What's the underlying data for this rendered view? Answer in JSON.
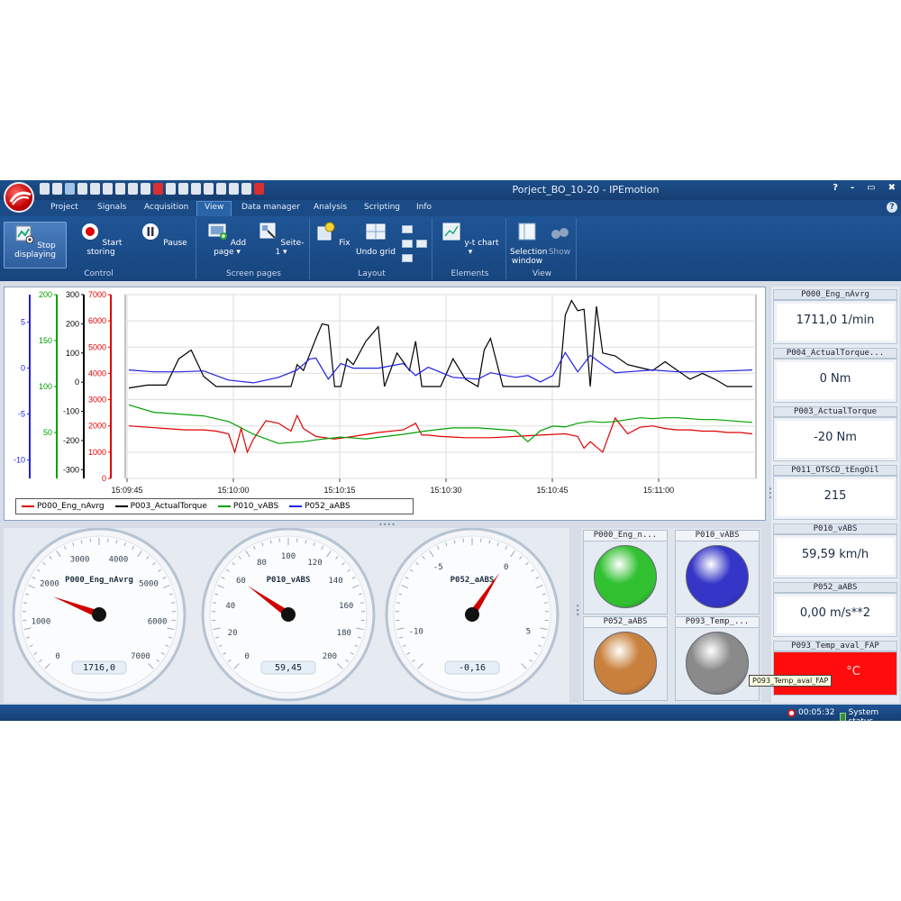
{
  "window": {
    "title": "Porject_BO_10-20 - IPEmotion"
  },
  "menu_tabs": [
    "Project",
    "Signals",
    "Acquisition",
    "View",
    "Data manager",
    "Analysis",
    "Scripting",
    "Info"
  ],
  "active_tab": "View",
  "window_buttons": {
    "help": "?",
    "minimize": "-",
    "restore": "▭",
    "close": "✖"
  },
  "ribbon": {
    "control": {
      "label": "Control",
      "stop_displaying": "Stop displaying",
      "start_storing": "Start storing",
      "pause": "Pause"
    },
    "screen_pages": {
      "label": "Screen pages",
      "add_page": "Add page ▾",
      "seite": "Seite-1 ▾"
    },
    "layout": {
      "label": "Layout",
      "fix": "Fix",
      "undo_grid": "Undo grid"
    },
    "elements": {
      "label": "Elements",
      "yt_chart": "y-t chart ▾"
    },
    "view": {
      "label": "View",
      "selection_window": "Selection window",
      "show": "Show"
    }
  },
  "chart_data": {
    "type": "line",
    "x_ticks": [
      "15:09:45",
      "15:10:00",
      "15:10:15",
      "15:10:30",
      "15:10:45",
      "15:11:00"
    ],
    "axes": [
      {
        "name": "P052_aABS",
        "color": "#2020e0",
        "ticks": [
          "5",
          "0",
          "-5",
          "-10"
        ],
        "range": [
          -12,
          8
        ]
      },
      {
        "name": "P010_vABS",
        "color": "#00a000",
        "ticks": [
          "200",
          "150",
          "100",
          "50"
        ],
        "range": [
          0,
          200
        ]
      },
      {
        "name": "P003_ActualTorque",
        "color": "#000000",
        "ticks": [
          "300",
          "200",
          "100",
          "0",
          "-100",
          "-200",
          "-300"
        ],
        "range": [
          -330,
          300
        ]
      },
      {
        "name": "P000_Eng_nAvrg",
        "color": "#e00000",
        "ticks": [
          "7000",
          "6000",
          "5000",
          "4000",
          "3000",
          "2000",
          "1000",
          "0"
        ],
        "range": [
          0,
          7000
        ]
      }
    ],
    "series": [
      {
        "name": "P000_Eng_nAvrg",
        "color": "#e00000",
        "x": [
          0,
          3,
          6,
          9,
          12,
          14,
          16,
          17,
          18,
          19,
          20,
          22,
          24,
          26,
          27,
          28,
          30,
          33,
          36,
          40,
          44,
          46,
          47,
          48,
          50,
          54,
          58,
          62,
          66,
          70,
          72,
          73,
          74,
          76,
          78,
          80,
          82,
          84,
          85,
          86,
          88,
          90,
          92,
          94,
          96,
          98,
          100
        ],
        "y": [
          2000,
          1950,
          1900,
          1850,
          1850,
          1800,
          1700,
          1000,
          1900,
          1000,
          1500,
          2200,
          2100,
          1800,
          2400,
          1900,
          1600,
          1500,
          1600,
          1750,
          1850,
          2100,
          1650,
          1650,
          1600,
          1550,
          1550,
          1600,
          1650,
          1700,
          1600,
          1150,
          1400,
          1000,
          2300,
          1700,
          1950,
          2000,
          1950,
          1900,
          1850,
          1850,
          1800,
          1800,
          1750,
          1750,
          1700
        ]
      },
      {
        "name": "P003_ActualTorque",
        "color": "#000000",
        "x": [
          0,
          3,
          6,
          8,
          10,
          12,
          14,
          16,
          20,
          22,
          24,
          26,
          27,
          28,
          30,
          31,
          32,
          33,
          34,
          35,
          36,
          38,
          40,
          41,
          43,
          45,
          46,
          47,
          48,
          50,
          52,
          54,
          56,
          57,
          58,
          60,
          62,
          64,
          66,
          68,
          69,
          70,
          71,
          72,
          73,
          74,
          75,
          76,
          78,
          80,
          82,
          84,
          86,
          88,
          90,
          92,
          94,
          96,
          98,
          100
        ],
        "y": [
          -20,
          -10,
          -10,
          80,
          110,
          20,
          -15,
          -15,
          -15,
          -15,
          -15,
          -15,
          60,
          40,
          150,
          200,
          195,
          -15,
          -15,
          80,
          60,
          140,
          190,
          -15,
          100,
          40,
          140,
          -15,
          -15,
          -15,
          80,
          10,
          -15,
          110,
          150,
          -15,
          -15,
          -15,
          -15,
          -15,
          -15,
          230,
          280,
          245,
          250,
          -15,
          260,
          100,
          90,
          60,
          50,
          40,
          70,
          40,
          10,
          30,
          10,
          -15,
          -15,
          -15
        ]
      },
      {
        "name": "P010_vABS",
        "color": "#00a000",
        "x": [
          0,
          4,
          8,
          12,
          16,
          20,
          24,
          28,
          30,
          34,
          38,
          44,
          48,
          52,
          56,
          58,
          60,
          62,
          64,
          66,
          68,
          70,
          72,
          74,
          76,
          78,
          80,
          82,
          84,
          86,
          88,
          90,
          92,
          94,
          96,
          98,
          100
        ],
        "y": [
          80,
          72,
          70,
          68,
          62,
          48,
          38,
          40,
          42,
          45,
          43,
          48,
          52,
          55,
          55,
          54,
          53,
          52,
          40,
          52,
          57,
          56,
          60,
          62,
          61,
          62,
          64,
          66,
          65,
          66,
          66,
          65,
          64,
          64,
          63,
          62,
          61
        ]
      },
      {
        "name": "P052_aABS",
        "color": "#2020e0",
        "x": [
          0,
          4,
          8,
          12,
          16,
          20,
          24,
          27,
          29,
          30,
          32,
          34,
          36,
          40,
          44,
          46,
          48,
          52,
          56,
          58,
          62,
          64,
          66,
          68,
          70,
          72,
          74,
          76,
          78,
          80,
          84,
          88,
          92,
          96,
          100
        ],
        "y": [
          -0.2,
          -0.4,
          -0.4,
          -0.3,
          -1.3,
          -1.6,
          -1.0,
          -0.2,
          1.0,
          1.1,
          -1.2,
          0.5,
          0,
          0,
          0.5,
          -0.8,
          0.1,
          -1.0,
          -1.2,
          -0.5,
          -1.0,
          -0.8,
          -1.5,
          -0.8,
          1.7,
          -0.4,
          1.4,
          0.4,
          -0.5,
          -0.4,
          -0.2,
          -0.4,
          -0.4,
          -0.3,
          -0.2
        ]
      }
    ]
  },
  "legend": [
    "P000_Eng_nAvrg",
    "P003_ActualTorque",
    "P010_vABS",
    "P052_aABS"
  ],
  "value_panel": [
    {
      "name": "P000_Eng_nAvrg",
      "value": "1711,0 1/min"
    },
    {
      "name": "P004_ActualTorque...",
      "value": "0 Nm"
    },
    {
      "name": "P003_ActualTorque",
      "value": "-20 Nm"
    },
    {
      "name": "P011_OTSCD_tEngOil",
      "value": "215"
    },
    {
      "name": "P010_vABS",
      "value": "59,59 km/h"
    },
    {
      "name": "P052_aABS",
      "value": "0,00 m/s**2"
    },
    {
      "name": "P093_Temp_aval_FAP",
      "value": "°C"
    }
  ],
  "gauges": [
    {
      "name": "P000_Eng_nAvrg",
      "value": "1716,0",
      "ticks": [
        "0",
        "1000",
        "2000",
        "3000",
        "4000",
        "5000",
        "6000",
        "7000"
      ],
      "reading": 1716,
      "min": 0,
      "max": 7000
    },
    {
      "name": "P010_vABS",
      "value": "59,45",
      "ticks": [
        "0",
        "20",
        "40",
        "60",
        "80",
        "100",
        "120",
        "140",
        "160",
        "180",
        "200"
      ],
      "reading": 59.45,
      "min": 0,
      "max": 200
    },
    {
      "name": "P052_aABS",
      "value": "-0,16",
      "ticks": [
        "-10",
        "-5",
        "0",
        "5"
      ],
      "reading": -0.16,
      "min": -12,
      "max": 7
    }
  ],
  "lamps": [
    {
      "name": "P000_Eng_n...",
      "color": "#30c030"
    },
    {
      "name": "P010_vABS",
      "color": "#3535c8"
    },
    {
      "name": "P052_aABS",
      "color": "#c8803c"
    },
    {
      "name": "P093_Temp_...",
      "color": "#8a8a8a"
    }
  ],
  "tooltip": "P093_Temp_aval_FAP",
  "status": {
    "timer": "00:05:32",
    "system": "System status"
  }
}
